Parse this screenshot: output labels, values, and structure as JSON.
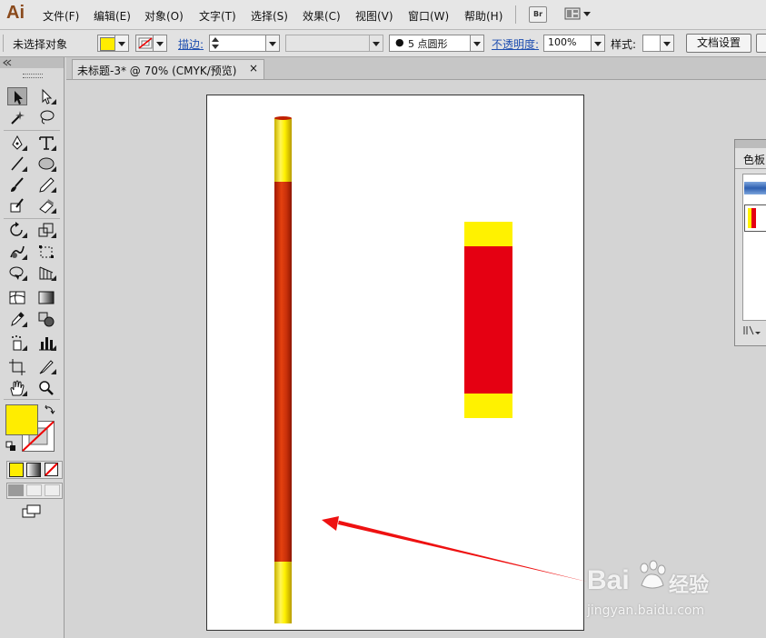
{
  "app": {
    "logo": "Ai"
  },
  "menu": [
    "文件(F)",
    "编辑(E)",
    "对象(O)",
    "文字(T)",
    "选择(S)",
    "效果(C)",
    "视图(V)",
    "窗口(W)",
    "帮助(H)"
  ],
  "menubar": {
    "bridge_label": "Br"
  },
  "controlbar": {
    "selection_status": "未选择对象",
    "stroke_label": "描边:",
    "brush_value": "5 点圆形",
    "opacity_label": "不透明度:",
    "opacity_value": "100%",
    "style_label": "样式:",
    "doc_setup_button": "文档设置"
  },
  "document": {
    "tab_title": "未标题-3* @ 70% (CMYK/预览)",
    "close_glyph": "×"
  },
  "panels": {
    "swatches_title": "色板"
  },
  "watermark": {
    "brand": "Bai",
    "brand_suffix": "经验",
    "url": "jingyan.baidu.com"
  },
  "colors": {
    "fill": "#ffed00",
    "red": "#e50012",
    "yellow": "#fff200",
    "arrow": "#ee1111"
  }
}
